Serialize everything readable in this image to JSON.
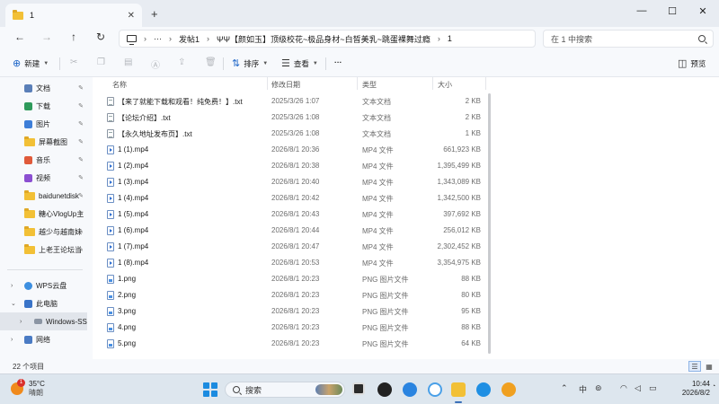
{
  "window": {
    "tab_title": "1",
    "new_tab": "+",
    "minimize": "—",
    "maximize": "☐",
    "close": "✕"
  },
  "address": {
    "more": "···",
    "crumbs": [
      "发帖1",
      "ΨΨ【颜如玉】顶级校花~极品身材~白皙美乳~跳蛋裸舞过瘾",
      "1"
    ],
    "sep": "›",
    "search_placeholder": "在 1 中搜索"
  },
  "commands": {
    "new": "新建",
    "sort": "排序",
    "view": "查看",
    "more": "···",
    "preview": "预览"
  },
  "sidebar": {
    "quick": [
      {
        "label": "文档",
        "icon": "document-icon",
        "color": "#5a7fb8"
      },
      {
        "label": "下载",
        "icon": "download-icon",
        "color": "#2e9a5b"
      },
      {
        "label": "图片",
        "icon": "pictures-icon",
        "color": "#3d7ed8"
      },
      {
        "label": "屏幕截图",
        "icon": "folder-icon",
        "color": "#f2c036"
      },
      {
        "label": "音乐",
        "icon": "music-icon",
        "color": "#e05a3a"
      },
      {
        "label": "视频",
        "icon": "video-icon",
        "color": "#8b4fd1"
      },
      {
        "label": "baidunetdisk",
        "icon": "folder-icon",
        "color": "#f2c036"
      },
      {
        "label": "糖心VlogUp主",
        "icon": "folder-icon",
        "color": "#f2c036"
      },
      {
        "label": "越少与越南妹",
        "icon": "folder-icon",
        "color": "#f2c036"
      },
      {
        "label": "上老王论坛当",
        "icon": "folder-icon",
        "color": "#f2c036"
      }
    ],
    "wps": "WPS云盘",
    "this_pc": "此电脑",
    "drive": "Windows-SSD",
    "network": "网络"
  },
  "columns": {
    "name": "名称",
    "date": "修改日期",
    "type": "类型",
    "size": "大小"
  },
  "files": [
    {
      "name": "【来了就能下载和观看！纯免费！】.txt",
      "date": "2025/3/26 1:07",
      "type": "文本文档",
      "size": "2 KB",
      "kind": "txt"
    },
    {
      "name": "【论坛介绍】.txt",
      "date": "2025/3/26 1:08",
      "type": "文本文档",
      "size": "2 KB",
      "kind": "txt"
    },
    {
      "name": "【永久地址发布页】.txt",
      "date": "2025/3/26 1:08",
      "type": "文本文档",
      "size": "1 KB",
      "kind": "txt"
    },
    {
      "name": "1 (1).mp4",
      "date": "2026/8/1 20:36",
      "type": "MP4 文件",
      "size": "661,923 KB",
      "kind": "mp4"
    },
    {
      "name": "1 (2).mp4",
      "date": "2026/8/1 20:38",
      "type": "MP4 文件",
      "size": "1,395,499 KB",
      "kind": "mp4"
    },
    {
      "name": "1 (3).mp4",
      "date": "2026/8/1 20:40",
      "type": "MP4 文件",
      "size": "1,343,089 KB",
      "kind": "mp4"
    },
    {
      "name": "1 (4).mp4",
      "date": "2026/8/1 20:42",
      "type": "MP4 文件",
      "size": "1,342,500 KB",
      "kind": "mp4"
    },
    {
      "name": "1 (5).mp4",
      "date": "2026/8/1 20:43",
      "type": "MP4 文件",
      "size": "397,692 KB",
      "kind": "mp4"
    },
    {
      "name": "1 (6).mp4",
      "date": "2026/8/1 20:44",
      "type": "MP4 文件",
      "size": "256,012 KB",
      "kind": "mp4"
    },
    {
      "name": "1 (7).mp4",
      "date": "2026/8/1 20:47",
      "type": "MP4 文件",
      "size": "2,302,452 KB",
      "kind": "mp4"
    },
    {
      "name": "1 (8).mp4",
      "date": "2026/8/1 20:53",
      "type": "MP4 文件",
      "size": "3,354,975 KB",
      "kind": "mp4"
    },
    {
      "name": "1.png",
      "date": "2026/8/1 20:23",
      "type": "PNG 图片文件",
      "size": "88 KB",
      "kind": "png"
    },
    {
      "name": "2.png",
      "date": "2026/8/1 20:23",
      "type": "PNG 图片文件",
      "size": "80 KB",
      "kind": "png"
    },
    {
      "name": "3.png",
      "date": "2026/8/1 20:23",
      "type": "PNG 图片文件",
      "size": "95 KB",
      "kind": "png"
    },
    {
      "name": "4.png",
      "date": "2026/8/1 20:23",
      "type": "PNG 图片文件",
      "size": "88 KB",
      "kind": "png"
    },
    {
      "name": "5.png",
      "date": "2026/8/1 20:23",
      "type": "PNG 图片文件",
      "size": "64 KB",
      "kind": "png"
    }
  ],
  "status": {
    "item_count": "22 个项目"
  },
  "taskbar": {
    "weather_badge": "1",
    "temp": "35°C",
    "weather": "晴朗",
    "search": "搜索",
    "time": "10:44",
    "date": "2026/8/2",
    "ime": "中"
  }
}
